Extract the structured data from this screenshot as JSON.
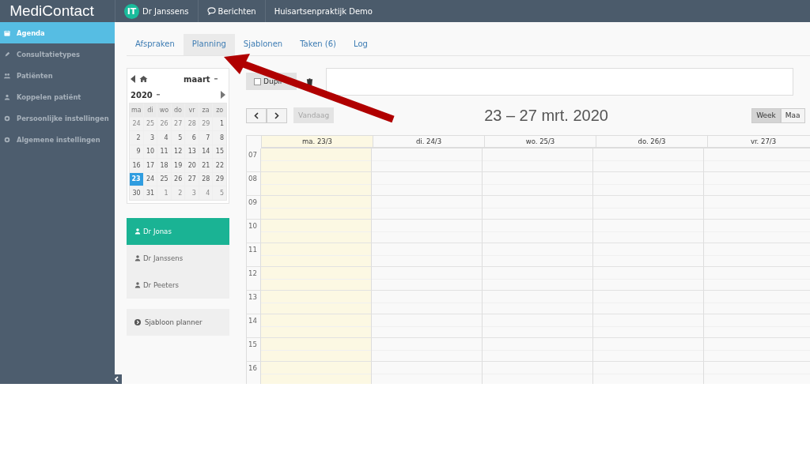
{
  "topbar": {
    "brand": "MediContact",
    "avatar": "IT",
    "user": "Dr Janssens",
    "messages": "Berichten",
    "practice": "Huisartsenpraktijk Demo"
  },
  "sidebar": {
    "items": [
      {
        "label": "Agenda",
        "kind": "calendar",
        "selected": true
      },
      {
        "label": "Consultatietypes",
        "kind": "pencil",
        "selected": false
      },
      {
        "label": "Patiënten",
        "kind": "users",
        "selected": false
      },
      {
        "label": "Koppelen patiënt",
        "kind": "user",
        "selected": false
      },
      {
        "label": "Persoonlijke instellingen",
        "kind": "gear",
        "selected": false
      },
      {
        "label": "Algemene instellingen",
        "kind": "gear",
        "selected": false
      }
    ]
  },
  "tabs": [
    {
      "label": "Afspraken",
      "selected": false
    },
    {
      "label": "Planning",
      "selected": true
    },
    {
      "label": "Sjablonen",
      "selected": false
    },
    {
      "label": "Taken (6)",
      "selected": false
    },
    {
      "label": "Log",
      "selected": false
    }
  ],
  "mini_calendar": {
    "month": "maart",
    "year": "2020",
    "weekdays": [
      "ma",
      "di",
      "wo",
      "do",
      "vr",
      "za",
      "zo"
    ],
    "weeks": [
      [
        {
          "day": "24",
          "muted": true,
          "selected": false
        },
        {
          "day": "25",
          "muted": true,
          "selected": false
        },
        {
          "day": "26",
          "muted": true,
          "selected": false
        },
        {
          "day": "27",
          "muted": true,
          "selected": false
        },
        {
          "day": "28",
          "muted": true,
          "selected": false
        },
        {
          "day": "29",
          "muted": true,
          "selected": false
        },
        {
          "day": "1",
          "muted": false,
          "selected": false
        }
      ],
      [
        {
          "day": "2",
          "muted": false,
          "selected": false
        },
        {
          "day": "3",
          "muted": false,
          "selected": false
        },
        {
          "day": "4",
          "muted": false,
          "selected": false
        },
        {
          "day": "5",
          "muted": false,
          "selected": false
        },
        {
          "day": "6",
          "muted": false,
          "selected": false
        },
        {
          "day": "7",
          "muted": false,
          "selected": false
        },
        {
          "day": "8",
          "muted": false,
          "selected": false
        }
      ],
      [
        {
          "day": "9",
          "muted": false,
          "selected": false
        },
        {
          "day": "10",
          "muted": false,
          "selected": false
        },
        {
          "day": "11",
          "muted": false,
          "selected": false
        },
        {
          "day": "12",
          "muted": false,
          "selected": false
        },
        {
          "day": "13",
          "muted": false,
          "selected": false
        },
        {
          "day": "14",
          "muted": false,
          "selected": false
        },
        {
          "day": "15",
          "muted": false,
          "selected": false
        }
      ],
      [
        {
          "day": "16",
          "muted": false,
          "selected": false
        },
        {
          "day": "17",
          "muted": false,
          "selected": false
        },
        {
          "day": "18",
          "muted": false,
          "selected": false
        },
        {
          "day": "19",
          "muted": false,
          "selected": false
        },
        {
          "day": "20",
          "muted": false,
          "selected": false
        },
        {
          "day": "21",
          "muted": false,
          "selected": false
        },
        {
          "day": "22",
          "muted": false,
          "selected": false
        }
      ],
      [
        {
          "day": "23",
          "muted": false,
          "selected": true
        },
        {
          "day": "24",
          "muted": false,
          "selected": false
        },
        {
          "day": "25",
          "muted": false,
          "selected": false
        },
        {
          "day": "26",
          "muted": false,
          "selected": false
        },
        {
          "day": "27",
          "muted": false,
          "selected": false
        },
        {
          "day": "28",
          "muted": false,
          "selected": false
        },
        {
          "day": "29",
          "muted": false,
          "selected": false
        }
      ],
      [
        {
          "day": "30",
          "muted": false,
          "selected": false
        },
        {
          "day": "31",
          "muted": false,
          "selected": false
        },
        {
          "day": "1",
          "muted": true,
          "selected": false
        },
        {
          "day": "2",
          "muted": true,
          "selected": false
        },
        {
          "day": "3",
          "muted": true,
          "selected": false
        },
        {
          "day": "4",
          "muted": true,
          "selected": false
        },
        {
          "day": "5",
          "muted": true,
          "selected": false
        }
      ]
    ]
  },
  "doctors": [
    {
      "label": "Dr Jonas",
      "selected": true
    },
    {
      "label": "Dr Janssens",
      "selected": false
    },
    {
      "label": "Dr Peeters",
      "selected": false
    }
  ],
  "template_button": "Sjabloon planner",
  "duplicate": {
    "label": "Dupli",
    "checked": false
  },
  "today_button": {
    "label": "Vandaag",
    "disabled": true
  },
  "title": "23 – 27 mrt. 2020",
  "views": [
    {
      "label": "Week",
      "selected": true
    },
    {
      "label": "Maa",
      "selected": false
    }
  ],
  "days": [
    {
      "label": "ma. 23/3",
      "today": true
    },
    {
      "label": "di. 24/3",
      "today": false
    },
    {
      "label": "wo. 25/3",
      "today": false
    },
    {
      "label": "do. 26/3",
      "today": false
    },
    {
      "label": "vr. 27/3",
      "today": false
    }
  ],
  "hours": [
    "07",
    "08",
    "09",
    "10",
    "11",
    "12",
    "13",
    "14",
    "15",
    "16"
  ]
}
